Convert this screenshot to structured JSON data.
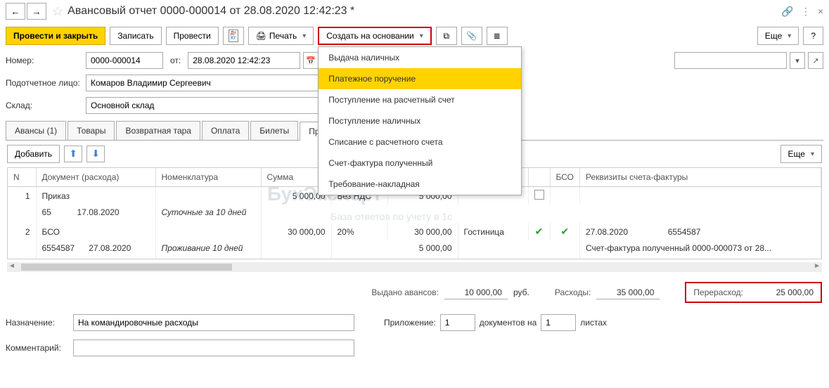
{
  "title": "Авансовый отчет 0000-000014 от 28.08.2020 12:42:23 *",
  "toolbar": {
    "submit_close": "Провести и закрыть",
    "save": "Записать",
    "submit": "Провести",
    "print": "Печать",
    "create_based": "Создать на основании",
    "more": "Еще",
    "help": "?"
  },
  "fields": {
    "number_label": "Номер:",
    "number": "0000-000014",
    "from_label": "от:",
    "date": "28.08.2020 12:42:23",
    "person_label": "Подотчетное лицо:",
    "person": "Комаров Владимир Сергеевич",
    "warehouse_label": "Склад:",
    "warehouse": "Основной склад"
  },
  "tabs": [
    "Авансы (1)",
    "Товары",
    "Возвратная тара",
    "Оплата",
    "Билеты",
    "Прочее (2)"
  ],
  "active_tab": 5,
  "table_toolbar": {
    "add": "Добавить",
    "more": "Еще"
  },
  "columns": [
    "N",
    "Документ (расхода)",
    "Номенклатура",
    "Сумма",
    "",
    "",
    "",
    "",
    "БСО",
    "Реквизиты счета-фактуры"
  ],
  "rows": [
    {
      "n": "1",
      "doc": "Приказ",
      "nomen": "",
      "sum": "5 000,00",
      "vat": "Без НДС",
      "total": "5 000,00",
      "supplier": "",
      "sf": false,
      "bso": "",
      "req": "",
      "doc2": "65",
      "date2": "17.08.2020",
      "nomen2": "Суточные за 10 дней",
      "sum2": "",
      "req2": ""
    },
    {
      "n": "2",
      "doc": "БСО",
      "nomen": "",
      "sum": "30 000,00",
      "vat": "20%",
      "total": "30 000,00",
      "supplier": "Гостиница",
      "sf": true,
      "bso": true,
      "req_date": "27.08.2020",
      "req_num": "6554587",
      "doc2": "6554587",
      "date2": "27.08.2020",
      "nomen2": "Проживание 10 дней",
      "sum2": "5 000,00",
      "req2": "Счет-фактура полученный 0000-000073 от 28..."
    }
  ],
  "summary": {
    "advances_label": "Выдано авансов:",
    "advances": "10 000,00",
    "currency": "руб.",
    "expenses_label": "Расходы:",
    "expenses": "35 000,00",
    "overrun_label": "Перерасход:",
    "overrun": "25 000,00"
  },
  "bottom": {
    "purpose_label": "Назначение:",
    "purpose": "На командировочные расходы",
    "attach_label": "Приложение:",
    "attach_count": "1",
    "docs_on": "документов на",
    "sheets_count": "1",
    "sheets": "листах",
    "comment_label": "Комментарий:"
  },
  "dropdown": {
    "items": [
      "Выдача наличных",
      "Платежное поручение",
      "Поступление на расчетный счет",
      "Поступление наличных",
      "Списание с расчетного счета",
      "Счет-фактура полученный",
      "Требование-накладная"
    ],
    "hover": 1
  },
  "watermark": "БухЭксперт",
  "watermark_sub": "База ответов по учету в 1с"
}
